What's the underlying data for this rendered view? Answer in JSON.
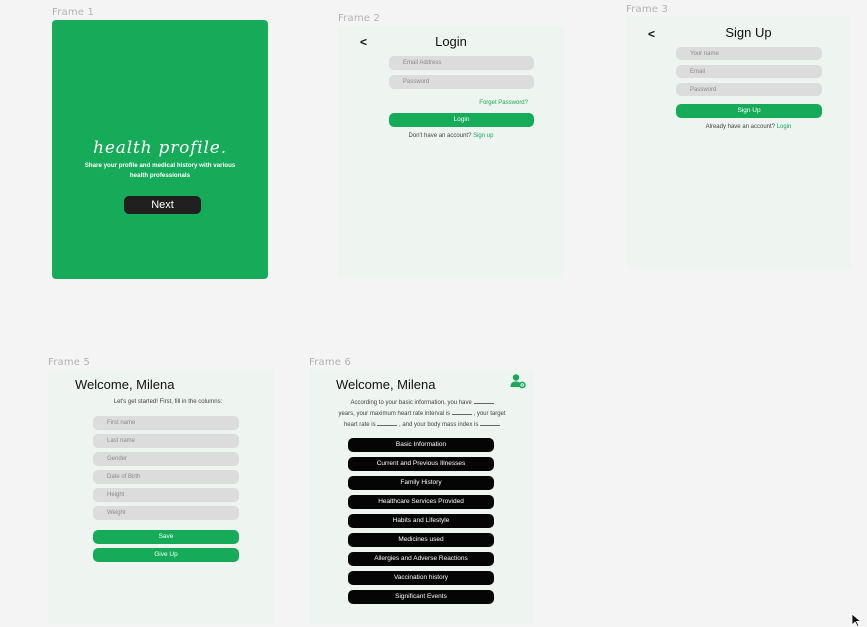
{
  "frames": {
    "f1": {
      "label": "Frame 1",
      "title": "health profile.",
      "subtitle": "Share your profile and medical history with various health professionals",
      "next_label": "Next"
    },
    "f2": {
      "label": "Frame 2",
      "back": "<",
      "title": "Login",
      "email_placeholder": "Email Address",
      "password_placeholder": "Password",
      "forgot": "Forget Password?",
      "login_label": "Login",
      "no_account": "Don't have an account?",
      "signup_link": "Sign up"
    },
    "f3": {
      "label": "Frame 3",
      "back": "<",
      "title": "Sign Up",
      "name_placeholder": "Your name",
      "email_placeholder": "Email",
      "password_placeholder": "Password",
      "signup_label": "Sign Up",
      "have_account": "Already have an account?",
      "login_link": "Login"
    },
    "f5": {
      "label": "Frame 5",
      "title": "Welcome, Milena",
      "intro": "Let's get started! First, fill in the columns:",
      "fields": [
        "First name",
        "Last name",
        "Gender",
        "Date of Birth",
        "Height",
        "Weight"
      ],
      "save_label": "Save",
      "giveup_label": "Give Up"
    },
    "f6": {
      "label": "Frame 6",
      "title": "Welcome, Milena",
      "info_1": "According to your basic information, you have",
      "info_2": "years, your maximum heart rate interval is",
      "info_3": ", your target",
      "info_4": "heart rate is",
      "info_5": ", and your body mass index is",
      "menu": [
        "Basic Information",
        "Current and Previous Illnesses",
        "Family History",
        "Healthcare Services Provided",
        "Habits and Lifestyle",
        "Medicines used",
        "Allergies and Adverse Reactions",
        "Vaccination history",
        "Significant Events"
      ]
    }
  },
  "colors": {
    "accent": "#16ab59",
    "frame_bg": "#eef4ef",
    "canvas_bg": "#f4f4f4",
    "button_dark": "#050505"
  },
  "icons": {
    "frame6_top_right": "user-settings-icon",
    "cursor": "mouse-pointer-icon"
  }
}
